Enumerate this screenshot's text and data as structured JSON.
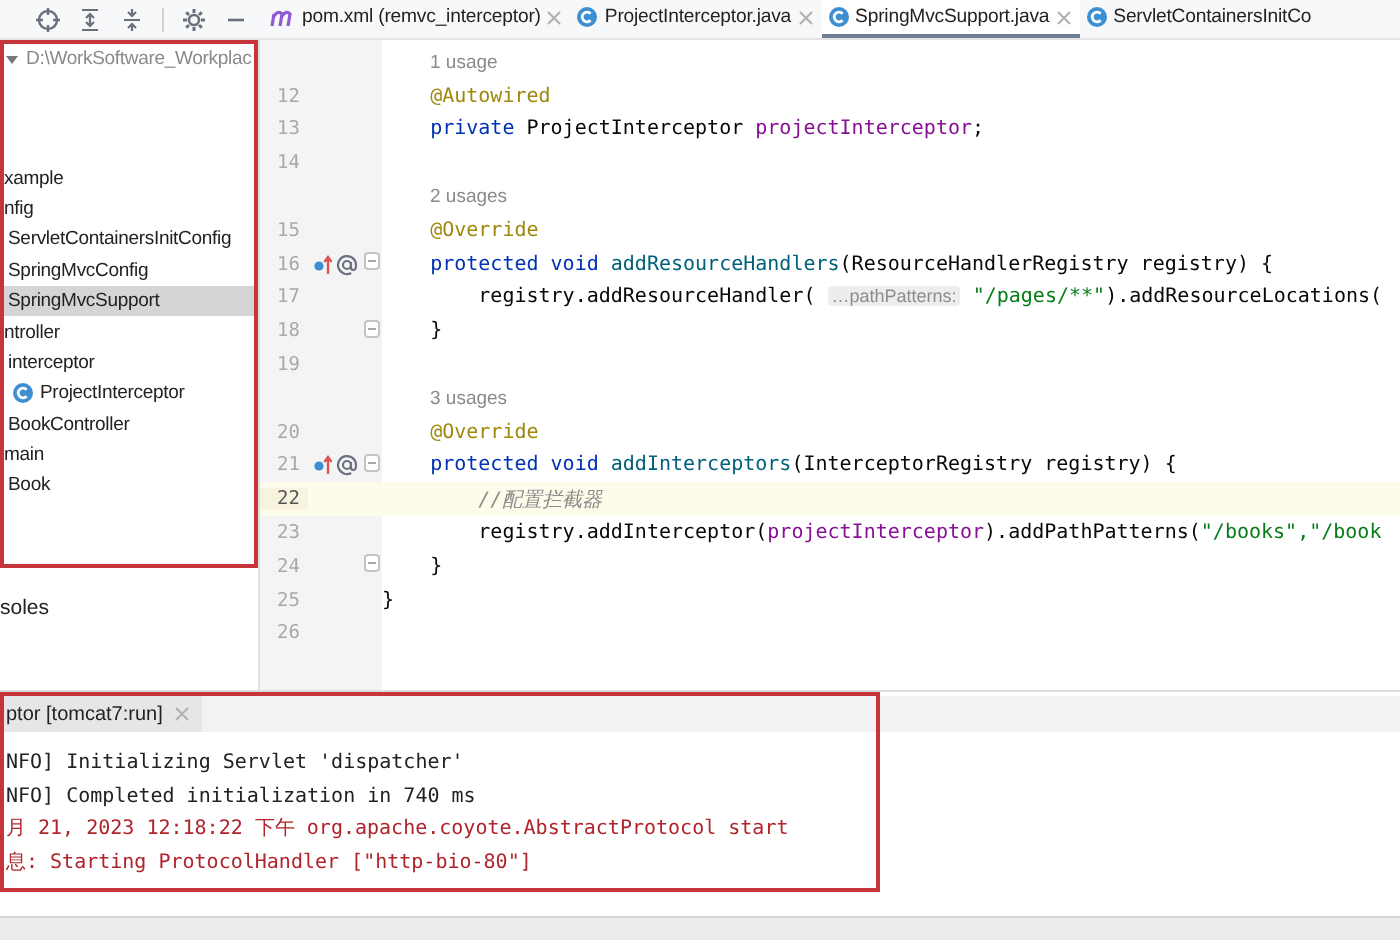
{
  "toolbar": {
    "tools": [
      {
        "kind": "locate"
      },
      {
        "kind": "expand"
      },
      {
        "kind": "collapse"
      },
      {
        "kind": "settings"
      },
      {
        "kind": "hide"
      }
    ]
  },
  "tabs": [
    {
      "label": "pom.xml (remvc_interceptor)",
      "kind": "maven",
      "closable": true,
      "selected": false
    },
    {
      "label": "ProjectInterceptor.java",
      "kind": "class",
      "closable": true,
      "selected": false
    },
    {
      "label": "SpringMvcSupport.java",
      "kind": "class",
      "closable": true,
      "selected": true
    },
    {
      "label": "ServletContainersInitCo",
      "kind": "class",
      "closable": false,
      "selected": false
    }
  ],
  "project_tree": {
    "highlighted": true,
    "root": {
      "label": "D:\\WorkSoftware_Workplac",
      "expanded": true
    },
    "items": [
      {
        "label": "xample",
        "selected": false,
        "children": [
          {
            "label": "nfig",
            "selected": false,
            "children": [
              {
                "label": "ServletContainersInitConfig",
                "selected": false
              },
              {
                "label": "SpringMvcConfig",
                "selected": false
              },
              {
                "label": "SpringMvcSupport",
                "selected": true
              }
            ]
          },
          {
            "label": "ntroller",
            "selected": false,
            "children": [
              {
                "label": "interceptor",
                "selected": false,
                "children": [
                  {
                    "label": "ProjectInterceptor",
                    "kind": "class",
                    "selected": false
                  }
                ]
              },
              {
                "label": "BookController",
                "selected": false
              }
            ]
          },
          {
            "label": "main",
            "selected": false,
            "children": [
              {
                "label": "Book",
                "selected": false
              }
            ]
          }
        ]
      }
    ]
  },
  "scratches": {
    "label": "soles"
  },
  "editor": {
    "lines": [
      {
        "kind": "usage",
        "text": "1 usage"
      },
      {
        "kind": "code",
        "number": "12",
        "current": false,
        "fold": false,
        "markers": false,
        "tokens": [
          {
            "kind": "annotation",
            "text": "    @Autowired"
          }
        ]
      },
      {
        "kind": "code",
        "number": "13",
        "current": false,
        "fold": false,
        "markers": false,
        "tokens": [
          {
            "kind": "keyword",
            "text": "    private "
          },
          {
            "kind": "plain",
            "text": "ProjectInterceptor "
          },
          {
            "kind": "field",
            "text": "projectInterceptor"
          },
          {
            "kind": "plain",
            "text": ";"
          }
        ]
      },
      {
        "kind": "code",
        "number": "14",
        "current": false,
        "fold": false,
        "markers": false
      },
      {
        "kind": "usage",
        "text": "2 usages"
      },
      {
        "kind": "code",
        "number": "15",
        "current": false,
        "fold": false,
        "markers": false,
        "tokens": [
          {
            "kind": "annotation",
            "text": "    @Override"
          }
        ]
      },
      {
        "kind": "code",
        "number": "16",
        "current": false,
        "fold": true,
        "markers": true,
        "tokens": [
          {
            "kind": "keyword",
            "text": "    protected void "
          },
          {
            "kind": "method",
            "text": "addResourceHandlers"
          },
          {
            "kind": "plain",
            "text": "(ResourceHandlerRegistry registry) {"
          }
        ]
      },
      {
        "kind": "code",
        "number": "17",
        "current": false,
        "fold": false,
        "markers": false,
        "tokens": [
          {
            "kind": "plain",
            "text": "        registry.addResourceHandler( "
          },
          {
            "kind": "hint",
            "text": "…pathPatterns:"
          },
          {
            "kind": "string",
            "text": " \"/pages/**\""
          },
          {
            "kind": "plain",
            "text": ").addResourceLocations("
          }
        ]
      },
      {
        "kind": "code",
        "number": "18",
        "current": false,
        "fold": true,
        "markers": false,
        "tokens": [
          {
            "kind": "plain",
            "text": "    }"
          }
        ]
      },
      {
        "kind": "code",
        "number": "19",
        "current": false,
        "fold": false,
        "markers": false
      },
      {
        "kind": "usage",
        "text": "3 usages"
      },
      {
        "kind": "code",
        "number": "20",
        "current": false,
        "fold": false,
        "markers": false,
        "tokens": [
          {
            "kind": "annotation",
            "text": "    @Override"
          }
        ]
      },
      {
        "kind": "code",
        "number": "21",
        "current": false,
        "fold": true,
        "markers": true,
        "tokens": [
          {
            "kind": "keyword",
            "text": "    protected void "
          },
          {
            "kind": "method",
            "text": "addInterceptors"
          },
          {
            "kind": "plain",
            "text": "(InterceptorRegistry registry) {"
          }
        ]
      },
      {
        "kind": "code",
        "number": "22",
        "current": true,
        "fold": false,
        "markers": false,
        "tokens": [
          {
            "kind": "comment",
            "text": "        //配置拦截器"
          }
        ]
      },
      {
        "kind": "code",
        "number": "23",
        "current": false,
        "fold": false,
        "markers": false,
        "tokens": [
          {
            "kind": "plain",
            "text": "        registry.addInterceptor("
          },
          {
            "kind": "field",
            "text": "projectInterceptor"
          },
          {
            "kind": "plain",
            "text": ").addPathPatterns("
          },
          {
            "kind": "string",
            "text": "\"/books\",\"/book"
          }
        ]
      },
      {
        "kind": "code",
        "number": "24",
        "current": false,
        "fold": true,
        "markers": false,
        "tokens": [
          {
            "kind": "plain",
            "text": "    }"
          }
        ]
      },
      {
        "kind": "code",
        "number": "25",
        "current": false,
        "fold": false,
        "markers": false,
        "tokens": [
          {
            "kind": "plain",
            "text": "}"
          }
        ]
      },
      {
        "kind": "code",
        "number": "26",
        "current": false,
        "fold": false,
        "markers": false
      }
    ]
  },
  "console": {
    "highlighted": true,
    "tab": {
      "label": "ptor [tomcat7:run]",
      "selected": true
    },
    "lines": [
      {
        "kind": "info",
        "text": "NFO] Initializing Servlet 'dispatcher'"
      },
      {
        "kind": "info",
        "text": "NFO] Completed initialization in 740 ms"
      },
      {
        "kind": "error",
        "text": "月 21, 2023 12:18:22 下午 org.apache.coyote.AbstractProtocol start"
      },
      {
        "kind": "error",
        "text": "息: Starting ProtocolHandler [\"http-bio-80\"]"
      }
    ]
  }
}
